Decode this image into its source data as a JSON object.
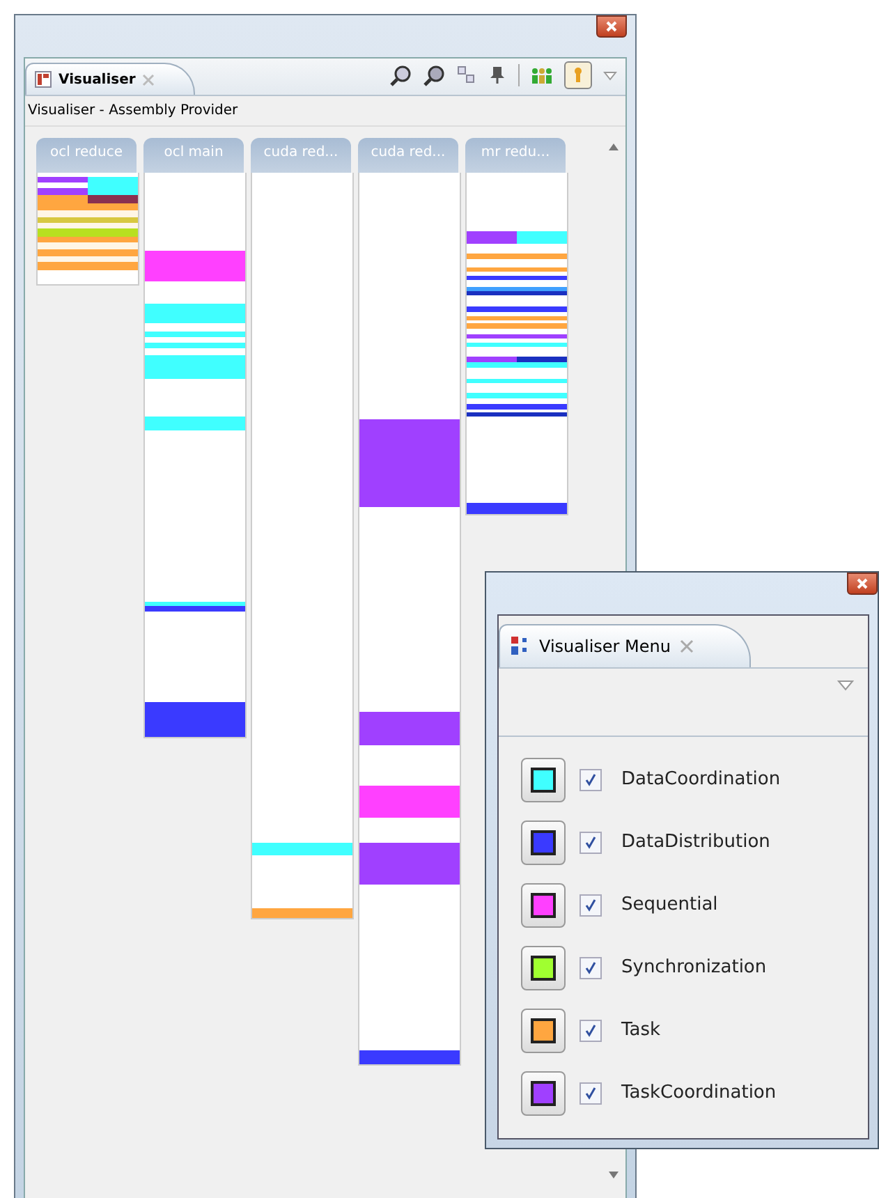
{
  "visualiser": {
    "tab": "Visualiser",
    "subtitle": "Visualiser - Assembly Provider",
    "lanes": [
      {
        "title": "ocl reduce"
      },
      {
        "title": "ocl main"
      },
      {
        "title": "cuda red..."
      },
      {
        "title": "cuda red..."
      },
      {
        "title": "mr redu..."
      }
    ]
  },
  "menu": {
    "tab": "Visualiser Menu",
    "items": [
      {
        "label": "DataCoordination",
        "color": "#40ffff",
        "checked": true
      },
      {
        "label": "DataDistribution",
        "color": "#3a3aff",
        "checked": true
      },
      {
        "label": "Sequential",
        "color": "#ff40ff",
        "checked": true
      },
      {
        "label": "Synchronization",
        "color": "#a0ff30",
        "checked": true
      },
      {
        "label": "Task",
        "color": "#ffa640",
        "checked": true
      },
      {
        "label": "TaskCoordination",
        "color": "#a040ff",
        "checked": true
      }
    ]
  }
}
